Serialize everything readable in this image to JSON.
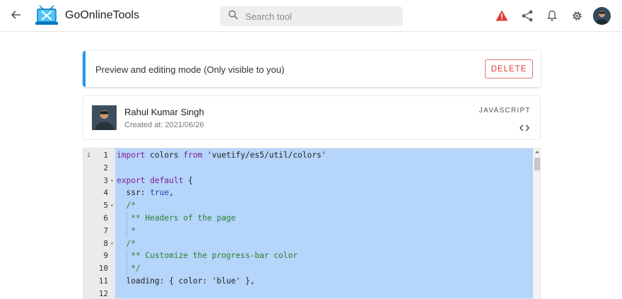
{
  "header": {
    "brand": "GoOnlineTools",
    "search_placeholder": "Search tool"
  },
  "banner": {
    "text": "Preview and editing mode (Only visible to you)",
    "delete_label": "DELETE"
  },
  "snippet": {
    "author": "Rahul Kumar Singh",
    "created": "Created at: 2021/06/26",
    "language": "JAVASCRIPT",
    "toggle_symbol": "<>"
  },
  "editor": {
    "gutter_info": "i",
    "lines": [
      {
        "n": "1",
        "fold": false,
        "guides": 0,
        "parts": [
          [
            "kw",
            "import"
          ],
          [
            "",
            "colors"
          ],
          [
            "kw",
            "from"
          ],
          [
            "str",
            "'vuetify/es5/util/colors'"
          ]
        ],
        "text": "import colors from 'vuetify/es5/util/colors'"
      },
      {
        "n": "2",
        "fold": false,
        "guides": 0,
        "text": ""
      },
      {
        "n": "3",
        "fold": true,
        "guides": 0,
        "text": "export default {"
      },
      {
        "n": "4",
        "fold": false,
        "guides": 0,
        "text": "  ssr: true,"
      },
      {
        "n": "5",
        "fold": true,
        "guides": 0,
        "text": "  /*"
      },
      {
        "n": "6",
        "fold": false,
        "guides": 1,
        "text": "   ** Headers of the page"
      },
      {
        "n": "7",
        "fold": false,
        "guides": 1,
        "text": "   *"
      },
      {
        "n": "8",
        "fold": true,
        "guides": 0,
        "text": "  /*"
      },
      {
        "n": "9",
        "fold": false,
        "guides": 1,
        "text": "   ** Customize the progress-bar color"
      },
      {
        "n": "10",
        "fold": false,
        "guides": 1,
        "text": "   */"
      },
      {
        "n": "11",
        "fold": false,
        "guides": 0,
        "text": "  loading: { color: 'blue' },"
      },
      {
        "n": "12",
        "fold": false,
        "guides": 0,
        "text": ""
      }
    ]
  },
  "colors": {
    "accent": "#2196f3",
    "danger": "#e53935",
    "selection": "#b5d5fb"
  }
}
